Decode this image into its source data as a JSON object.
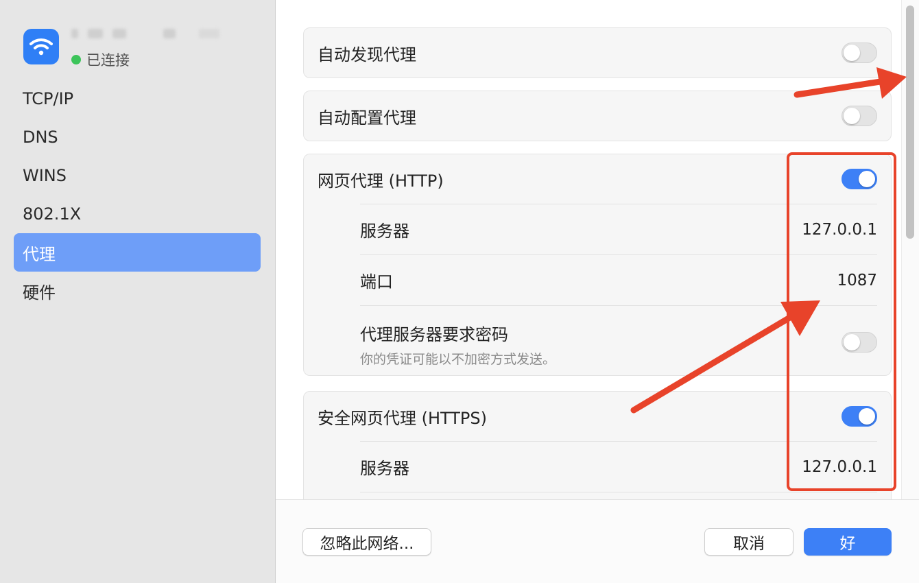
{
  "sidebar": {
    "network": {
      "status": "已连接"
    },
    "items": [
      {
        "label": "TCP/IP"
      },
      {
        "label": "DNS"
      },
      {
        "label": "WINS"
      },
      {
        "label": "802.1X"
      },
      {
        "label": "代理"
      },
      {
        "label": "硬件"
      }
    ],
    "active_index": 4
  },
  "proxies": {
    "auto_discovery": {
      "label": "自动发现代理",
      "enabled": false
    },
    "auto_config": {
      "label": "自动配置代理",
      "enabled": false
    },
    "http": {
      "label": "网页代理 (HTTP)",
      "enabled": true,
      "server_label": "服务器",
      "server_value": "127.0.0.1",
      "port_label": "端口",
      "port_value": "1087",
      "password_label": "代理服务器要求密码",
      "password_note": "你的凭证可能以不加密方式发送。",
      "password_required": false
    },
    "https": {
      "label": "安全网页代理 (HTTPS)",
      "enabled": true,
      "server_label": "服务器",
      "server_value": "127.0.0.1"
    }
  },
  "footer": {
    "forget_label": "忽略此网络...",
    "cancel_label": "取消",
    "ok_label": "好"
  },
  "colors": {
    "accent": "#3d80f6",
    "annotation": "#e8432a"
  }
}
